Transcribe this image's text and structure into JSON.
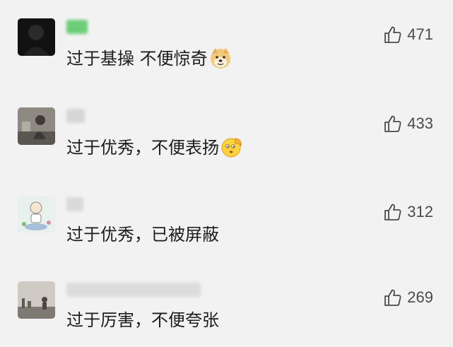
{
  "comments": [
    {
      "text": "过于基操 不便惊奇",
      "emoji": "doge-emoji",
      "likes": "471",
      "like_icon": "thumbs-up-icon"
    },
    {
      "text": "过于优秀，不便表扬",
      "emoji": "salute-emoji",
      "likes": "433",
      "like_icon": "thumbs-up-icon"
    },
    {
      "text": "过于优秀，已被屏蔽",
      "likes": "312",
      "like_icon": "thumbs-up-icon"
    },
    {
      "text": "过于厉害，不便夸张",
      "likes": "269",
      "like_icon": "thumbs-up-icon"
    }
  ],
  "colors": {
    "background": "#f2f2f2",
    "text": "#1c1c1c",
    "like": "#4b4b4b",
    "nickname_badge": "#5fc96a"
  }
}
